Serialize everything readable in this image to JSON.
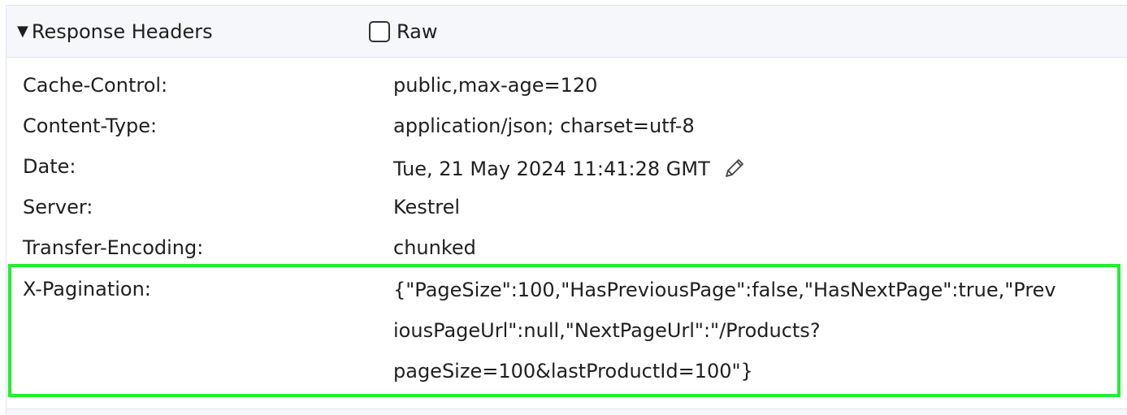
{
  "section": {
    "title": "Response Headers",
    "raw_label": "Raw",
    "raw_checked": false
  },
  "headers": [
    {
      "name": "Cache-Control:",
      "value": "public,max-age=120"
    },
    {
      "name": "Content-Type:",
      "value": "application/json; charset=utf-8"
    },
    {
      "name": "Date:",
      "value": "Tue, 21 May 2024 11:41:28 GMT"
    },
    {
      "name": "Server:",
      "value": "Kestrel"
    },
    {
      "name": "Transfer-Encoding:",
      "value": "chunked"
    }
  ],
  "pagination": {
    "name": "X-Pagination:",
    "value_lines": [
      "{\"PageSize\":100,\"HasPreviousPage\":false,\"HasNextPage\":true,\"Prev",
      "iousPageUrl\":null,\"NextPageUrl\":\"/Products?",
      "pageSize=100&lastProductId=100\"}"
    ]
  },
  "icons": {
    "collapse": "triangle-down-icon",
    "edit": "pencil-icon"
  },
  "colors": {
    "highlight": "#22ee33",
    "header_bg": "#f5f7fb"
  }
}
